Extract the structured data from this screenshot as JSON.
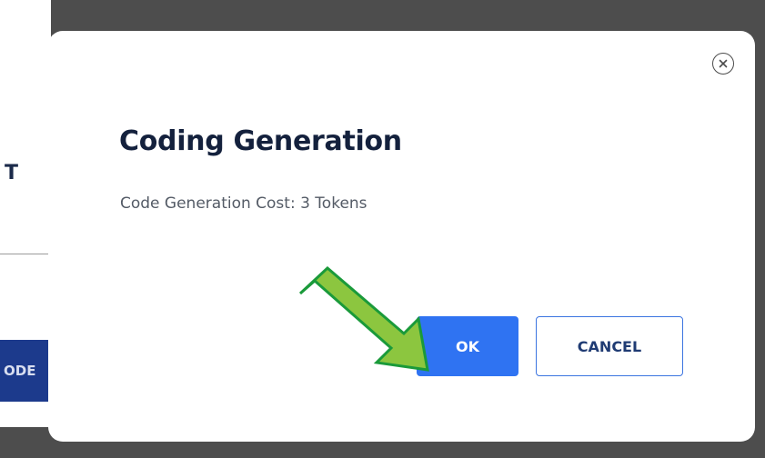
{
  "background_page": {
    "header_fragment": "T",
    "code_button_fragment": "ODE"
  },
  "dialog": {
    "title": "Coding Generation",
    "message": "Code Generation Cost: 3 Tokens",
    "ok_label": "OK",
    "cancel_label": "CANCEL",
    "close_icon": "close-circle-icon"
  },
  "annotation": {
    "icon": "green-arrow-icon",
    "color": "#8cc63f",
    "outline_color": "#1a9a3a"
  },
  "colors": {
    "primary": "#2f73f2",
    "title": "#14213d",
    "overlay": "#4d4d4d"
  }
}
